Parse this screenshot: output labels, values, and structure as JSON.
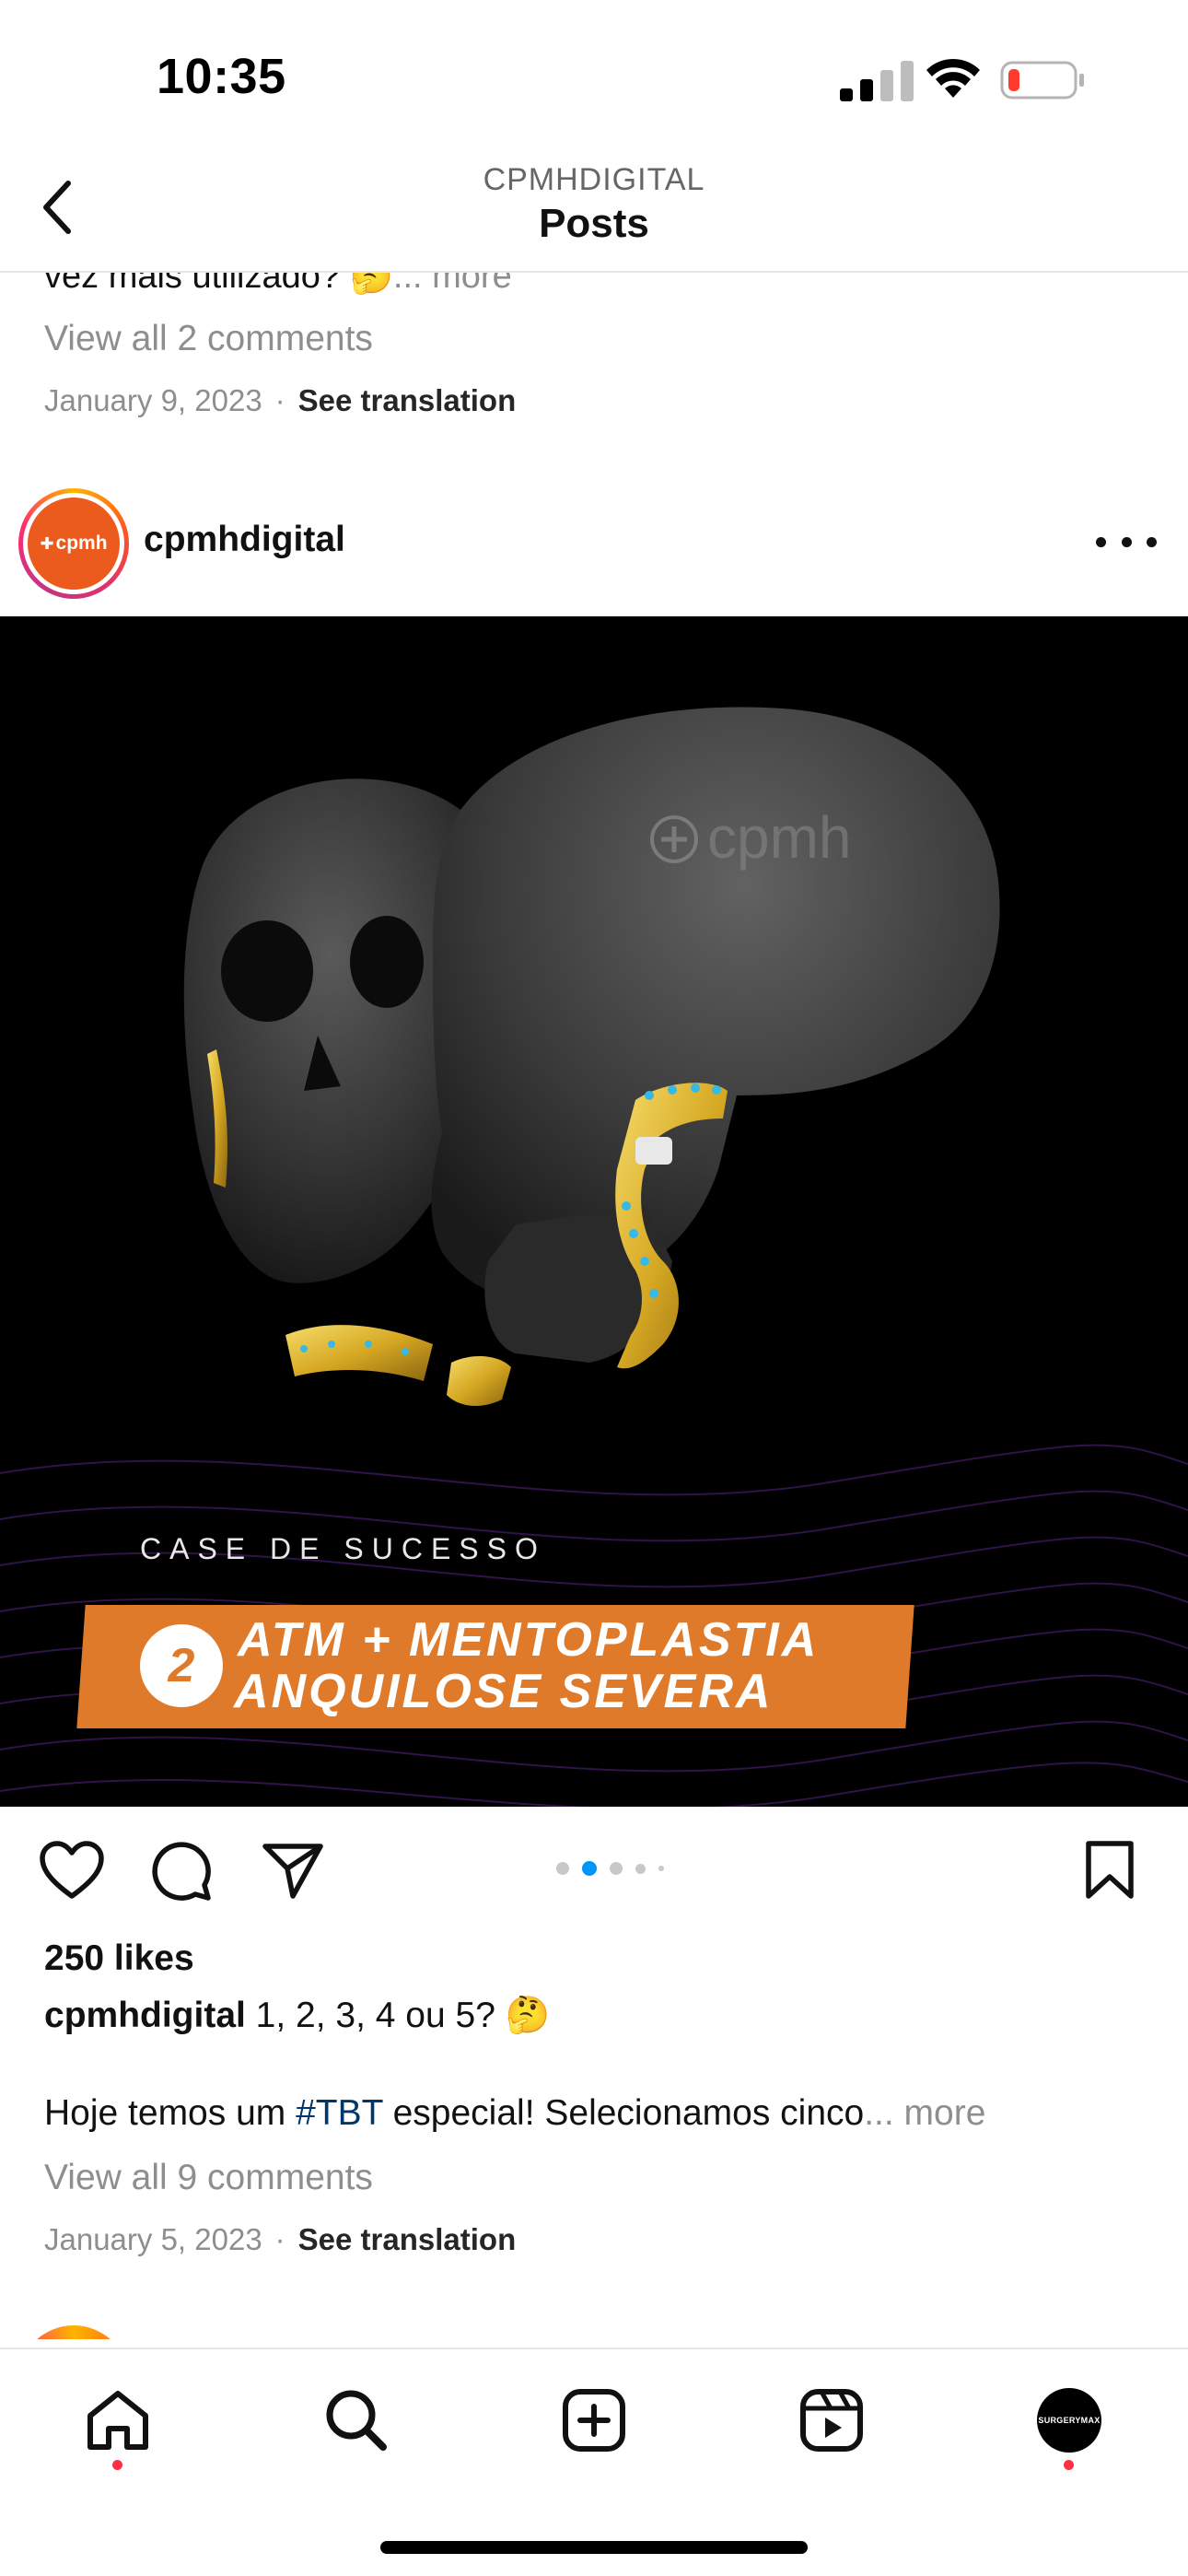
{
  "status_bar": {
    "time": "10:35"
  },
  "header": {
    "account": "CPMHDIGITAL",
    "title": "Posts"
  },
  "previous_post": {
    "caption_tail": "vez mais utilizado? 🤔",
    "more": "... more",
    "view_comments": "View all 2 comments",
    "date": "January 9, 2023",
    "separator": "·",
    "see_translation": "See translation"
  },
  "post": {
    "username": "cpmhdigital",
    "avatar_text": "cpmh",
    "image": {
      "skull_brand": "cpmh",
      "case_label": "CASE DE SUCESSO",
      "number": "2",
      "line1": "ATM + MENTOPLASTIA",
      "line2": "ANQUILOSE SEVERA"
    },
    "carousel": {
      "count": 5,
      "active_index": 1
    },
    "likes": "250 likes",
    "caption_user": "cpmhdigital",
    "caption_text": " 1, 2, 3, 4 ou 5? 🤔",
    "caption2_before": "Hoje temos um ",
    "caption2_hashtag": "#TBT",
    "caption2_after": " especial! Selecionamos cinco",
    "more": "... more",
    "view_comments": "View all 9 comments",
    "date": "January 5, 2023",
    "separator": "·",
    "see_translation": "See translation"
  },
  "bottom_nav": {
    "items": [
      "home-icon",
      "search-icon",
      "create-icon",
      "reels-icon",
      "profile-avatar"
    ],
    "profile_avatar_text": "SURGERYMAX"
  },
  "colors": {
    "accent_orange": "#df7a2b",
    "link_blue": "#00376b",
    "notification_red": "#ff3040",
    "carousel_active": "#0095f6"
  }
}
